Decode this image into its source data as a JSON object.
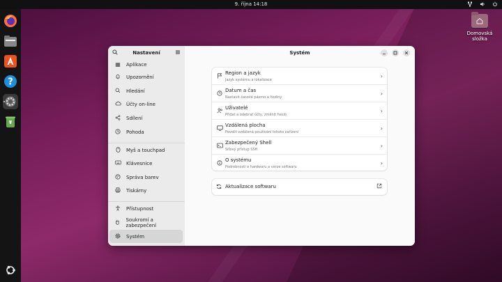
{
  "topbar": {
    "clock": "9. října  14:18",
    "tray_icons": [
      "network-icon",
      "volume-icon",
      "power-icon"
    ]
  },
  "dock": {
    "apps": [
      "firefox-icon",
      "files-icon",
      "app-center-icon",
      "help-icon",
      "settings-icon",
      "trash-icon"
    ],
    "active_app": "settings-icon"
  },
  "desktop": {
    "home_folder_label": "Domovská složka"
  },
  "window": {
    "sidebar": {
      "title": "Nastavení",
      "items": [
        {
          "label": "Aplikace",
          "icon": "apps-icon"
        },
        {
          "label": "Upozornění",
          "icon": "bell-icon"
        },
        {
          "label": "Hledání",
          "icon": "search-icon"
        },
        {
          "label": "Účty on-line",
          "icon": "cloud-icon"
        },
        {
          "label": "Sdílení",
          "icon": "share-icon"
        },
        {
          "label": "Pohoda",
          "icon": "wellbeing-icon"
        },
        {
          "label": "Myš a touchpad",
          "icon": "mouse-icon"
        },
        {
          "label": "Klávesnice",
          "icon": "keyboard-icon"
        },
        {
          "label": "Správa barev",
          "icon": "color-icon"
        },
        {
          "label": "Tiskárny",
          "icon": "printer-icon"
        },
        {
          "label": "Přístupnost",
          "icon": "accessibility-icon"
        },
        {
          "label": "Soukromí a zabezpečení",
          "icon": "hand-icon"
        },
        {
          "label": "Systém",
          "icon": "gear-icon",
          "selected": true
        }
      ]
    },
    "content": {
      "title": "Systém",
      "rows": [
        {
          "title": "Region a jazyk",
          "subtitle": "Jazyk systému a lokalizace",
          "icon": "flag-icon"
        },
        {
          "title": "Datum a čas",
          "subtitle": "Nastavit časové pásmo a hodiny",
          "icon": "clock-icon"
        },
        {
          "title": "Uživatelé",
          "subtitle": "Přidat a odebrat účty, změnit heslo",
          "icon": "users-icon"
        },
        {
          "title": "Vzdálená plocha",
          "subtitle": "Povolit vzdálená používání tohoto zařízení",
          "icon": "monitor-icon"
        },
        {
          "title": "Zabezpečený Shell",
          "subtitle": "Síťový přístup SSH",
          "icon": "terminal-icon"
        },
        {
          "title": "O systému",
          "subtitle": "Podrobnosti o hardwaru a verze softwaru",
          "icon": "info-icon"
        }
      ],
      "update_row": {
        "title": "Aktualizace softwaru",
        "icon": "refresh-icon"
      }
    }
  },
  "colors": {
    "accent_orange": "#e95420",
    "wallpaper": "#7a1f5c"
  }
}
